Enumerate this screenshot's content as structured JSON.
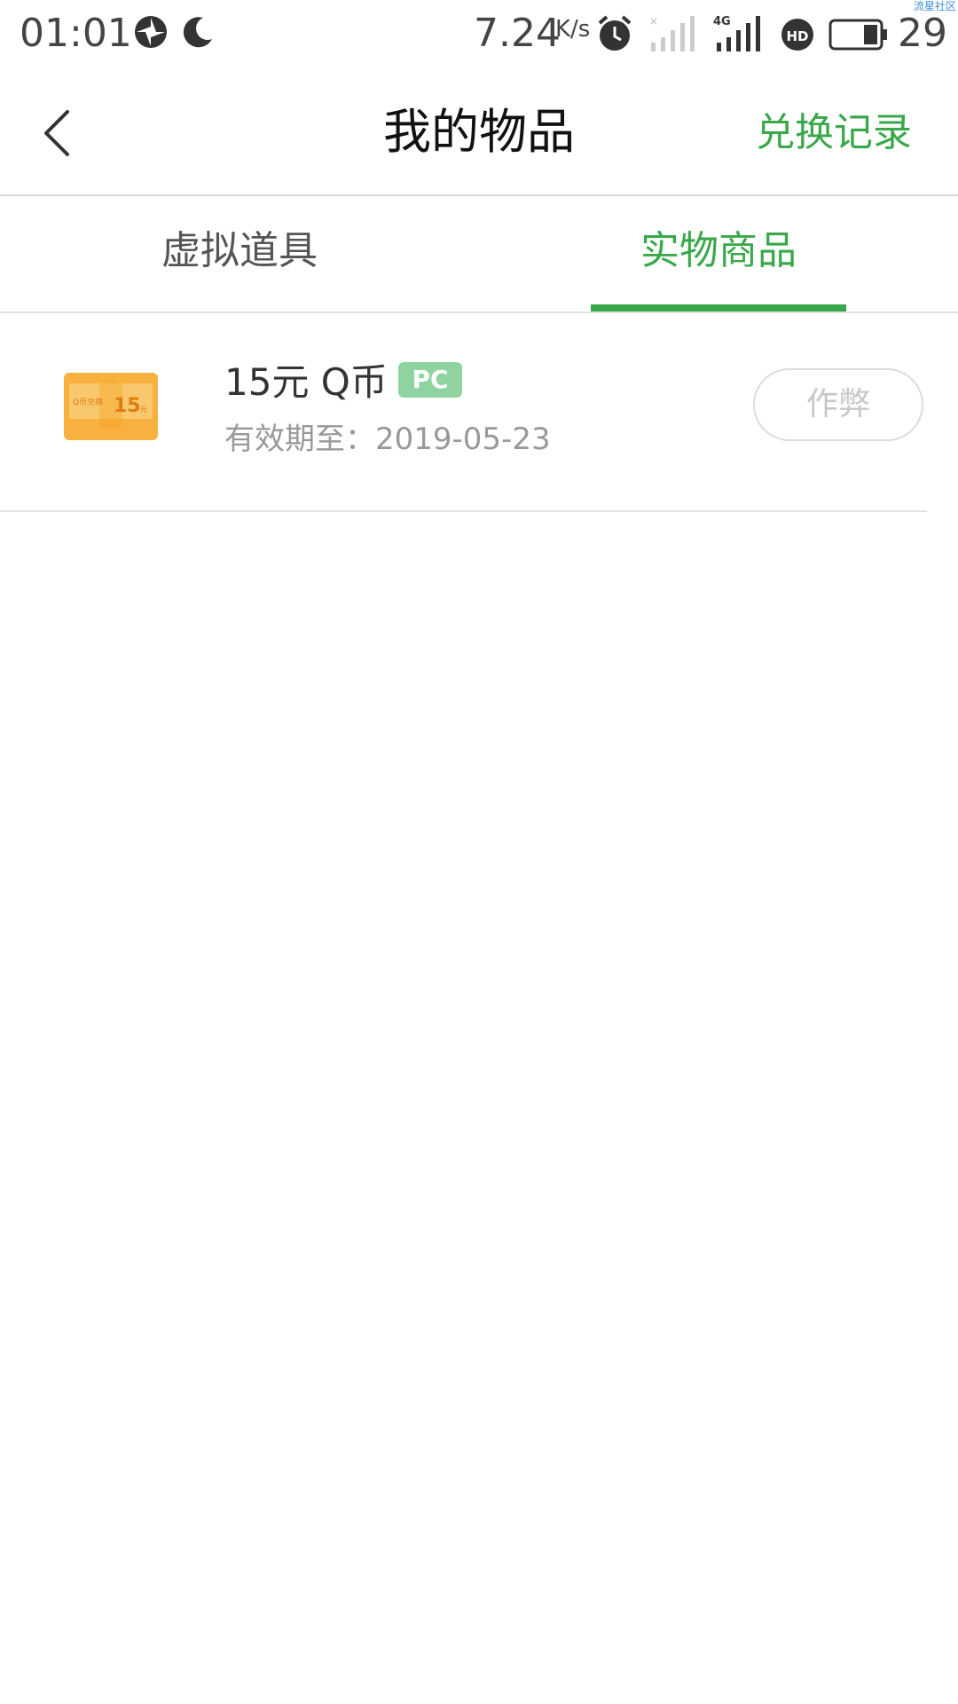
{
  "status_bar": {
    "time": "01:01",
    "net_speed": "7.24",
    "net_speed_unit": "K/s",
    "network": "4G",
    "hd_badge": "HD",
    "battery": "29",
    "watermark": "流星社区",
    "icons": [
      "aperture-icon",
      "moon-icon",
      "alarm-icon",
      "signal-empty-icon",
      "signal-4g-icon",
      "hd-call-icon",
      "battery-icon"
    ]
  },
  "header": {
    "back_icon": "chevron-left-icon",
    "title": "我的物品",
    "right_action": "兑换记录"
  },
  "tabs": [
    {
      "label": "虚拟道具",
      "active": false
    },
    {
      "label": "实物商品",
      "active": true
    }
  ],
  "items": [
    {
      "thumb_text": "Q币兑换",
      "thumb_value": "15",
      "thumb_unit": "元",
      "name": "15元 Q币",
      "tag": "PC",
      "expiry": "有效期至：2019-05-23",
      "action": "作弊"
    }
  ],
  "colors": {
    "accent": "#3aa84a",
    "tag_bg": "#8fd4a0",
    "divider": "#e3e3e3",
    "muted_text": "#999999",
    "thumb_orange": "#f8b13e"
  }
}
